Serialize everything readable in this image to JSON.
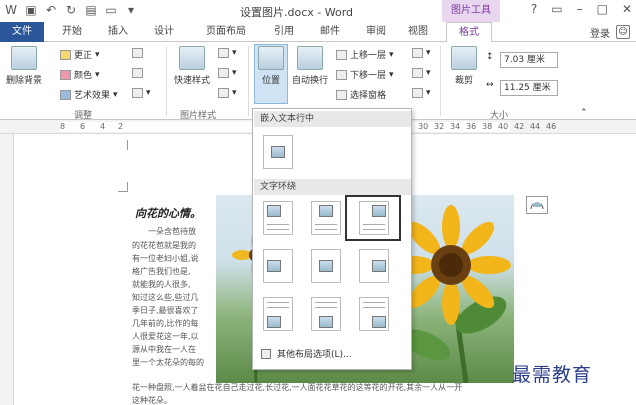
{
  "window": {
    "title": "设置图片.docx - Word",
    "context_tab": "图片工具",
    "help": "?",
    "restore": "▭",
    "minimize": "–",
    "maximize": "□",
    "close": "✕"
  },
  "tabs": [
    "文件",
    "开始",
    "插入",
    "设计",
    "页面布局",
    "引用",
    "邮件",
    "审阅",
    "视图",
    "格式"
  ],
  "account": {
    "login": "登录"
  },
  "ribbon": {
    "remove_bg": "删除背景",
    "adjust_items": [
      "更正",
      "颜色",
      "艺术效果"
    ],
    "adjust_label": "调整",
    "quick_styles": "快速样式",
    "picture_styles_label": "图片样式",
    "position": "位置",
    "auto_wrap": "自动换行",
    "arrange_items": [
      "上移一层",
      "下移一层",
      "选择窗格"
    ],
    "crop": "裁剪",
    "height_value": "7.03 厘米",
    "width_value": "11.25 厘米",
    "size_label": "大小"
  },
  "ruler": {
    "left_nums": [
      "8",
      "6",
      "4",
      "2"
    ],
    "right_nums": [
      "30",
      "32",
      "34",
      "36",
      "38",
      "40",
      "42",
      "44",
      "46"
    ]
  },
  "document": {
    "poem_title": "向花的心情。",
    "poem_lines": [
      "一朵含苞待放",
      "的花花苞就是我的",
      "有一位老妇小姐,说",
      "格广告我们也是,",
      "就能我的人很多,",
      "知过这么些,些过几",
      "季日子,最很喜欢了",
      "几年前的,比作的每",
      "人很爱花这一年,以",
      "源从中我在一人在",
      "里一个太花朵的每的"
    ],
    "bottom_line": "花一种盘照,一人着盆在花自己走过花,长过花,一人面花花草花的这等花的开花,其余一人从一开",
    "bottom_line2": "这种花朵。"
  },
  "dropdown": {
    "inline_header": "嵌入文本行中",
    "wrap_header": "文字环绕",
    "more_layout": "其他布局选项(L)..."
  },
  "watermark": "最需教育"
}
